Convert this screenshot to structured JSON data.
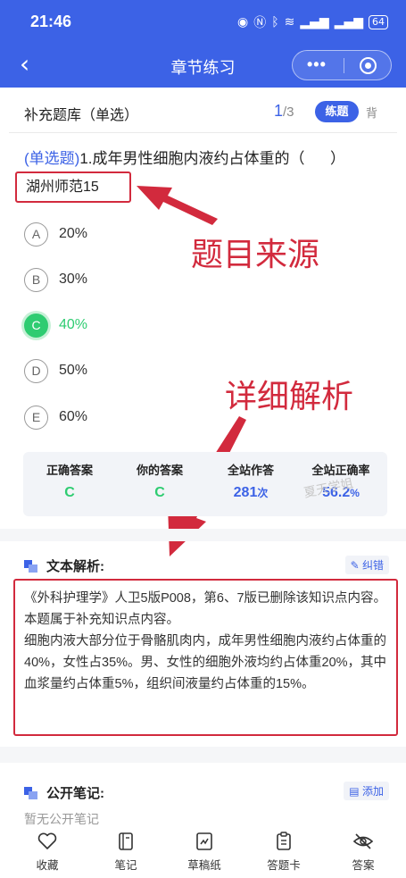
{
  "status": {
    "time": "21:46",
    "battery": "64"
  },
  "header": {
    "title": "章节练习",
    "back_icon": "chevron-left-icon"
  },
  "question_header": {
    "bank": "补充题库（单选）",
    "current": "1",
    "total": "/3",
    "mode_active": "练题",
    "mode_inactive": "背"
  },
  "question": {
    "type_label": "(单选题)",
    "text": "1.成年男性细胞内液约占体重的（",
    "close_paren": "）",
    "source": "湖州师范15"
  },
  "annotations": {
    "source_note": "题目来源",
    "analysis_note": "详细解析"
  },
  "options": [
    {
      "letter": "A",
      "text": "20%"
    },
    {
      "letter": "B",
      "text": "30%"
    },
    {
      "letter": "C",
      "text": "40%"
    },
    {
      "letter": "D",
      "text": "50%"
    },
    {
      "letter": "E",
      "text": "60%"
    }
  ],
  "stats": {
    "correct_label": "正确答案",
    "correct_value": "C",
    "yours_label": "你的答案",
    "yours_value": "C",
    "site_label": "全站作答",
    "site_value": "281",
    "site_unit": "次",
    "rate_label": "全站正确率",
    "rate_value": "56.2",
    "rate_unit": "%",
    "watermark": "夏天学姐"
  },
  "analysis": {
    "title": "文本解析:",
    "correct_btn": "纠错",
    "text": "《外科护理学》人卫5版P008，第6、7版已删除该知识点内容。本题属于补充知识点内容。\n细胞内液大部分位于骨骼肌肉内，成年男性细胞内液约占体重的40%，女性占35%。男、女性的细胞外液均约占体重20%，其中血浆量约占体重5%，组织间液量约占体重的15%。"
  },
  "notes": {
    "title": "公开笔记:",
    "add_btn": "添加",
    "empty": "暂无公开笔记"
  },
  "bottom_tabs": [
    {
      "label": "收藏",
      "icon": "heart-icon"
    },
    {
      "label": "笔记",
      "icon": "notebook-icon"
    },
    {
      "label": "草稿纸",
      "icon": "draft-paper-icon"
    },
    {
      "label": "答题卡",
      "icon": "answer-card-icon"
    },
    {
      "label": "答案",
      "icon": "eye-off-icon"
    }
  ],
  "colors": {
    "brand": "#3c62e6",
    "correct": "#2ecc71",
    "annotation": "#d22a3d"
  }
}
